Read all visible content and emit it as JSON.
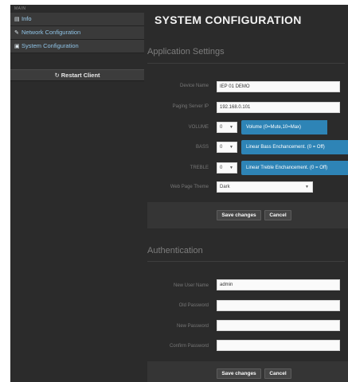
{
  "sidebar": {
    "header": "MAIN",
    "items": [
      {
        "label": "Info",
        "icon": "list-icon"
      },
      {
        "label": "Network Configuration",
        "icon": "wrench-icon"
      },
      {
        "label": "System Configuration",
        "icon": "settings-icon"
      }
    ],
    "restart_label": "Restart Client"
  },
  "page_title": "SYSTEM CONFIGURATION",
  "app_settings": {
    "title": "Application Settings",
    "device_name_label": "Device Name",
    "device_name_value": "IEP 01 DEMO",
    "paging_server_label": "Paging Server IP",
    "paging_server_value": "192.168.0.101",
    "volume_label": "VOLUME",
    "volume_value": "0",
    "volume_hint": "Volume (0=Mute,10=Max)",
    "bass_label": "BASS",
    "bass_value": "0",
    "bass_hint": "Linear Bass Enchancement. (0 = Off)",
    "treble_label": "TREBLE",
    "treble_value": "0",
    "treble_hint": "Linear Treble Enchancement. (0 = Off)",
    "theme_label": "Web Page Theme",
    "theme_value": "Dark",
    "save_label": "Save changes",
    "cancel_label": "Cancel"
  },
  "auth": {
    "title": "Authentication",
    "username_label": "New User Name",
    "username_value": "admin",
    "old_password_label": "Old Password",
    "new_password_label": "New Password",
    "confirm_password_label": "Confirm Password",
    "save_label": "Save changes",
    "cancel_label": "Cancel"
  },
  "colors": {
    "accent": "#2e84b6",
    "sidebar_bg": "#2b2b2b",
    "link": "#8fc3e6"
  }
}
